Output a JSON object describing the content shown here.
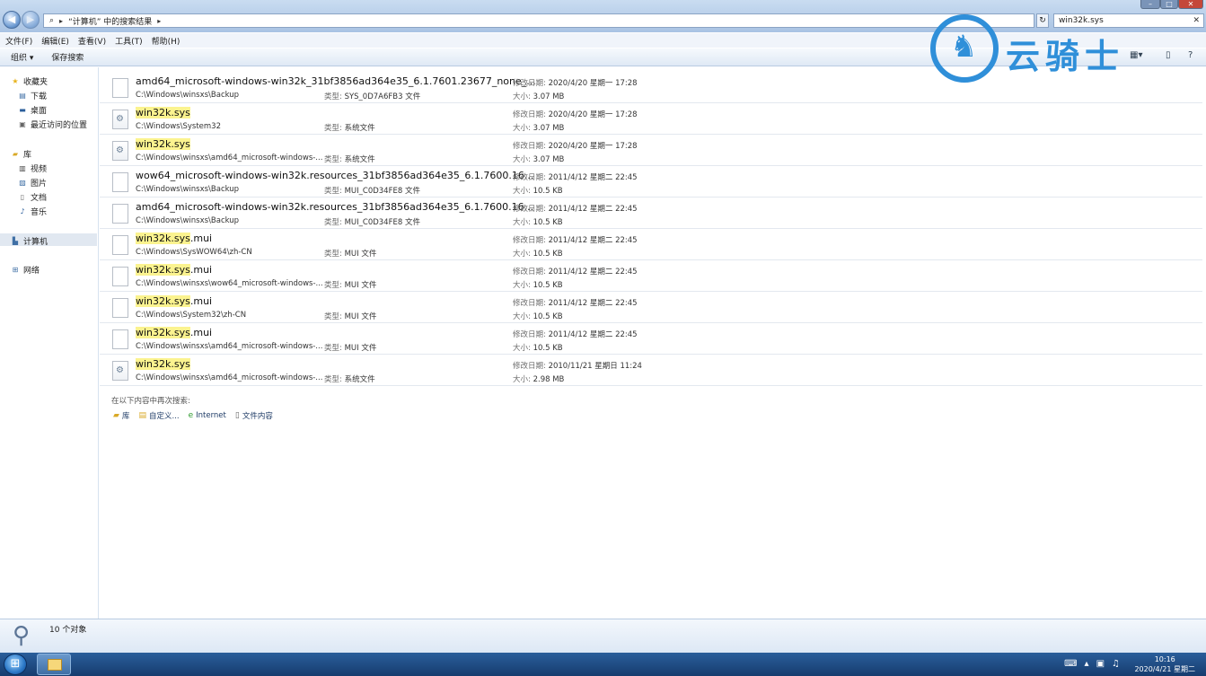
{
  "address": {
    "crumb": "“计算机” 中的搜索结果",
    "refresh_glyph": "↻"
  },
  "search": {
    "value": "win32k.sys",
    "clear_glyph": "✕"
  },
  "menu": [
    "文件(F)",
    "编辑(E)",
    "查看(V)",
    "工具(T)",
    "帮助(H)"
  ],
  "toolbar": {
    "organize": "组织 ▾",
    "save_search": "保存搜索"
  },
  "logo": {
    "text": "云骑士"
  },
  "sidebar": {
    "favorites": "收藏夹",
    "downloads": "下载",
    "desktop": "桌面",
    "recent": "最近访问的位置",
    "libraries": "库",
    "videos": "视频",
    "pictures": "图片",
    "documents": "文档",
    "music": "音乐",
    "computer": "计算机",
    "network": "网络"
  },
  "labels": {
    "date": "修改日期: ",
    "size": "大小: ",
    "type": "类型: "
  },
  "results": [
    {
      "hl": "",
      "name": "amd64_microsoft-windows-win32k_31bf3856ad364e35_6.1.7601.23677_none_...",
      "path": "C:\\Windows\\winsxs\\Backup",
      "type": "SYS_0D7A6FB3 文件",
      "date": "2020/4/20 星期一 17:28",
      "size": "3.07 MB",
      "sys": false
    },
    {
      "hl": "win32k.sys",
      "name": "",
      "path": "C:\\Windows\\System32",
      "type": "系统文件",
      "date": "2020/4/20 星期一 17:28",
      "size": "3.07 MB",
      "sys": true
    },
    {
      "hl": "win32k.sys",
      "name": "",
      "path": "C:\\Windows\\winsxs\\amd64_microsoft-windows-...",
      "type": "系统文件",
      "date": "2020/4/20 星期一 17:28",
      "size": "3.07 MB",
      "sys": true
    },
    {
      "hl": "",
      "name": "wow64_microsoft-windows-win32k.resources_31bf3856ad364e35_6.1.7600.16...",
      "path": "C:\\Windows\\winsxs\\Backup",
      "type": "MUI_C0D34FE8 文件",
      "date": "2011/4/12 星期二 22:45",
      "size": "10.5 KB",
      "sys": false
    },
    {
      "hl": "",
      "name": "amd64_microsoft-windows-win32k.resources_31bf3856ad364e35_6.1.7600.16...",
      "path": "C:\\Windows\\winsxs\\Backup",
      "type": "MUI_C0D34FE8 文件",
      "date": "2011/4/12 星期二 22:45",
      "size": "10.5 KB",
      "sys": false
    },
    {
      "hl": "win32k.sys",
      "name": ".mui",
      "path": "C:\\Windows\\SysWOW64\\zh-CN",
      "type": "MUI 文件",
      "date": "2011/4/12 星期二 22:45",
      "size": "10.5 KB",
      "sys": false
    },
    {
      "hl": "win32k.sys",
      "name": ".mui",
      "path": "C:\\Windows\\winsxs\\wow64_microsoft-windows-...",
      "type": "MUI 文件",
      "date": "2011/4/12 星期二 22:45",
      "size": "10.5 KB",
      "sys": false
    },
    {
      "hl": "win32k.sys",
      "name": ".mui",
      "path": "C:\\Windows\\System32\\zh-CN",
      "type": "MUI 文件",
      "date": "2011/4/12 星期二 22:45",
      "size": "10.5 KB",
      "sys": false
    },
    {
      "hl": "win32k.sys",
      "name": ".mui",
      "path": "C:\\Windows\\winsxs\\amd64_microsoft-windows-...",
      "type": "MUI 文件",
      "date": "2011/4/12 星期二 22:45",
      "size": "10.5 KB",
      "sys": false
    },
    {
      "hl": "win32k.sys",
      "name": "",
      "path": "C:\\Windows\\winsxs\\amd64_microsoft-windows-...",
      "type": "系统文件",
      "date": "2010/11/21 星期日 11:24",
      "size": "2.98 MB",
      "sys": true
    }
  ],
  "search_again": {
    "label": "在以下内容中再次搜索:",
    "library": "库",
    "custom": "自定义...",
    "internet": "Internet",
    "file_contents": "文件内容"
  },
  "details": {
    "count": "10 个对象"
  },
  "clock": {
    "time": "10:16",
    "date": "2020/4/21 星期二"
  },
  "colors": {
    "highlight": "#fbf38f",
    "logo": "#2f8fd9",
    "taskbar": "#1f4c85"
  }
}
